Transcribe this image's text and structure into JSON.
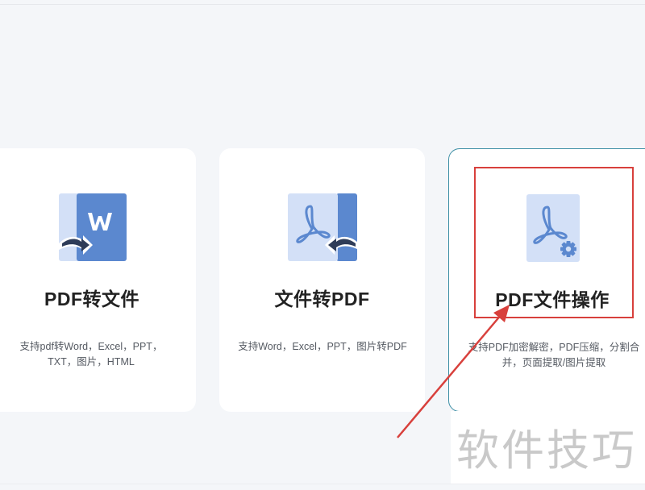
{
  "cards": [
    {
      "title": "PDF转文件",
      "description": "支持pdf转Word，Excel，PPT，TXT，图片，HTML",
      "icon": "pdf-to-word-icon"
    },
    {
      "title": "文件转PDF",
      "description": "支持Word，Excel，PPT，图片转PDF",
      "icon": "file-to-pdf-icon"
    },
    {
      "title": "PDF文件操作",
      "description": "支持PDF加密解密，PDF压缩，分割合并，页面提取/图片提取",
      "icon": "pdf-settings-icon"
    }
  ],
  "watermark": "软件技巧",
  "colors": {
    "accent_border": "#3f90a6",
    "highlight": "#d8403c",
    "icon_light": "#d3e0f7",
    "icon_dark": "#5b88cf"
  }
}
